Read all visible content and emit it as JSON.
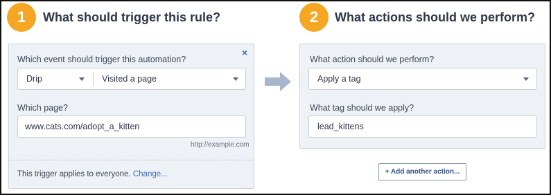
{
  "step1": {
    "number": "1",
    "title": "What should trigger this rule?",
    "event_label": "Which event should trigger this automation?",
    "source_value": "Drip",
    "event_value": "Visited a page",
    "page_label": "Which page?",
    "page_value": "www.cats.com/adopt_a_kitten",
    "page_hint": "http://example.com",
    "footer_text": "This trigger applies to everyone.",
    "footer_link": "Change...",
    "close_glyph": "×"
  },
  "step2": {
    "number": "2",
    "title": "What actions should we perform?",
    "action_label": "What action should we perform?",
    "action_value": "Apply a tag",
    "tag_label": "What tag should we apply?",
    "tag_value": "lead_kittens",
    "add_action_label": "+ Add another action..."
  },
  "colors": {
    "badge": "#f5a623",
    "card_bg": "#eef1f6",
    "link": "#3d6fb5",
    "arrow": "#a8b6cc"
  },
  "icons": {
    "close": "close-icon",
    "dropdown": "chevron-down-icon",
    "arrow": "arrow-right-icon"
  }
}
